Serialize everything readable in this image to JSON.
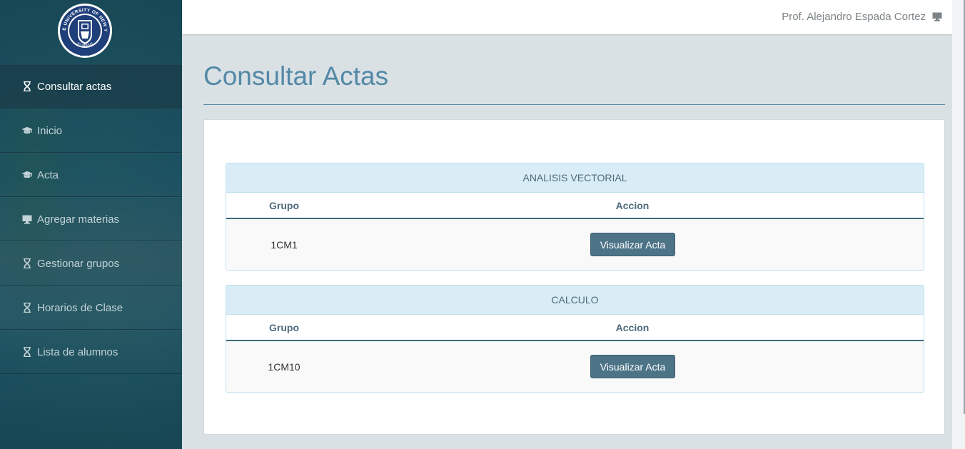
{
  "user": {
    "name": "Prof. Alejandro Espada Cortez",
    "icon": "monitor-icon"
  },
  "logo": {
    "ring_text_top": "STATE UNIVERSITY OF NEW YORK",
    "ring_text_bottom": "TO SERVE",
    "year": "1948"
  },
  "sidebar": {
    "items": [
      {
        "label": "Consultar actas",
        "icon": "hourglass-icon",
        "active": true
      },
      {
        "label": "Inicio",
        "icon": "graduation-cap-icon"
      },
      {
        "label": "Acta",
        "icon": "graduation-cap-icon"
      },
      {
        "label": "Agregar materias",
        "icon": "monitor-icon"
      },
      {
        "label": "Gestionar grupos",
        "icon": "hourglass-icon"
      },
      {
        "label": "Horarios de Clase",
        "icon": "hourglass-icon"
      },
      {
        "label": "Lista de alumnos",
        "icon": "hourglass-icon"
      }
    ]
  },
  "page": {
    "title": "Consultar Actas"
  },
  "subjects": [
    {
      "name": "ANALISIS VECTORIAL",
      "columns": [
        "Grupo",
        "Accion"
      ],
      "rows": [
        {
          "grupo": "1CM1",
          "action_label": "Visualizar Acta"
        }
      ]
    },
    {
      "name": "CALCULO",
      "columns": [
        "Grupo",
        "Accion"
      ],
      "rows": [
        {
          "grupo": "1CM10",
          "action_label": "Visualizar Acta"
        }
      ]
    }
  ],
  "colors": {
    "sidebar": "#1f5566",
    "accent": "#5389a6",
    "button": "#4c7386",
    "panel_header": "#d9edf7"
  }
}
